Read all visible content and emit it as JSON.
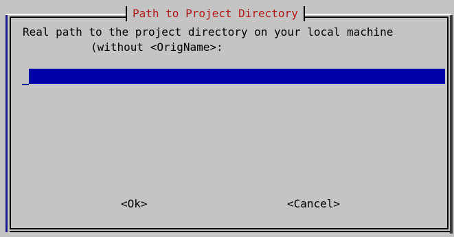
{
  "dialog": {
    "title": "Path to Project Directory",
    "prompt_line1": "Real path to the project directory on your local machine",
    "prompt_line2": "(without <OrigName>:",
    "input": {
      "value": "",
      "placeholder": ""
    },
    "buttons": {
      "ok_label": "<Ok>",
      "cancel_label": "<Cancel>"
    }
  },
  "colors": {
    "background": "#c4c4c4",
    "title_text": "#b01818",
    "input_bg": "#0000a8"
  }
}
